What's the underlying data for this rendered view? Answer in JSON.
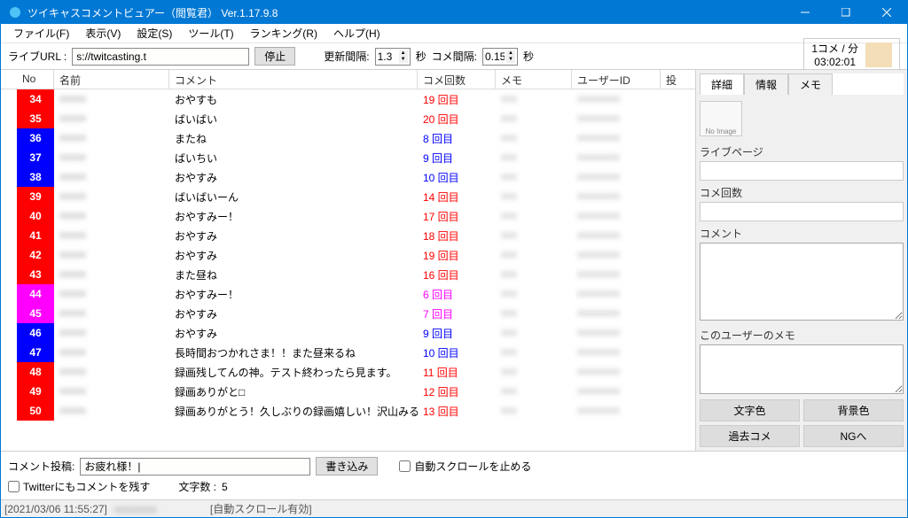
{
  "window": {
    "title": "ツイキャスコメントビュアー（閲覧君） Ver.1.17.9.8"
  },
  "menu": [
    "ファイル(F)",
    "表示(V)",
    "設定(S)",
    "ツール(T)",
    "ランキング(R)",
    "ヘルプ(H)"
  ],
  "toolbar": {
    "url_label": "ライブURL :",
    "url_value": "s://twitcasting.t",
    "stop": "停止",
    "refresh_label": "更新間隔:",
    "refresh_val": "1.3",
    "sec1": "秒",
    "comment_label": "コメ間隔:",
    "comment_val": "0.15",
    "sec2": "秒"
  },
  "status": {
    "line1": "1コメ / 分",
    "line2": "03:02:01"
  },
  "columns": {
    "scroll": "",
    "no": "No",
    "name": "名前",
    "comment": "コメント",
    "count": "コメ回数",
    "memo": "メモ",
    "uid": "ユーザーID",
    "q": "投"
  },
  "rows": [
    {
      "no": "34",
      "no_bg": "#ff0000",
      "comment": "おやすも",
      "count": "19 回目",
      "cc": "red"
    },
    {
      "no": "35",
      "no_bg": "#ff0000",
      "comment": "ばいばい",
      "count": "20 回目",
      "cc": "red"
    },
    {
      "no": "36",
      "no_bg": "#0000ff",
      "comment": "またね",
      "count": "8 回目",
      "cc": "blue"
    },
    {
      "no": "37",
      "no_bg": "#0000ff",
      "comment": "ばいちい",
      "count": "9 回目",
      "cc": "blue"
    },
    {
      "no": "38",
      "no_bg": "#0000ff",
      "comment": "おやすみ",
      "count": "10 回目",
      "cc": "blue"
    },
    {
      "no": "39",
      "no_bg": "#ff0000",
      "comment": "ばいばいーん",
      "count": "14 回目",
      "cc": "red"
    },
    {
      "no": "40",
      "no_bg": "#ff0000",
      "comment": "おやすみー！",
      "count": "17 回目",
      "cc": "red"
    },
    {
      "no": "41",
      "no_bg": "#ff0000",
      "comment": "おやすみ",
      "count": "18 回目",
      "cc": "red"
    },
    {
      "no": "42",
      "no_bg": "#ff0000",
      "comment": "おやすみ",
      "count": "19 回目",
      "cc": "red"
    },
    {
      "no": "43",
      "no_bg": "#ff0000",
      "comment": "また昼ね",
      "count": "16 回目",
      "cc": "red"
    },
    {
      "no": "44",
      "no_bg": "#ff00ff",
      "comment": "おやすみー！",
      "count": "6 回目",
      "cc": "magenta"
    },
    {
      "no": "45",
      "no_bg": "#ff00ff",
      "comment": "おやすみ",
      "count": "7 回目",
      "cc": "magenta"
    },
    {
      "no": "46",
      "no_bg": "#0000ff",
      "comment": "おやすみ",
      "count": "9 回目",
      "cc": "blue"
    },
    {
      "no": "47",
      "no_bg": "#0000ff",
      "comment": "長時間おつかれさま！！また昼来るね",
      "count": "10 回目",
      "cc": "blue"
    },
    {
      "no": "48",
      "no_bg": "#ff0000",
      "comment": "録画残してんの神。テスト終わったら見ます。",
      "count": "11 回目",
      "cc": "red"
    },
    {
      "no": "49",
      "no_bg": "#ff0000",
      "comment": "録画ありがと□",
      "count": "12 回目",
      "cc": "red"
    },
    {
      "no": "50",
      "no_bg": "#ff0000",
      "comment": "録画ありがとう！久しぶりの録画嬉しい！沢山みるねー😊",
      "count": "13 回目",
      "cc": "red"
    }
  ],
  "side": {
    "tabs": [
      "詳細",
      "情報",
      "メモ"
    ],
    "avatar": "No Image",
    "livepage": "ライブページ",
    "count": "コメ回数",
    "comment": "コメント",
    "usernote": "このユーザーのメモ",
    "btn_textcolor": "文字色",
    "btn_bgcolor": "背景色",
    "btn_pastcomment": "過去コメ",
    "btn_ng": "NGへ"
  },
  "bottom": {
    "post_label": "コメント投稿:",
    "post_value": "お疲れ様！|",
    "write": "書き込み",
    "stopscroll": "自動スクロールを止める",
    "twitter": "Twitterにもコメントを残す",
    "charcount_label": "文字数 :",
    "charcount_value": "5"
  },
  "statusbar": {
    "time": "[2021/03/06 11:55:27]",
    "scroll": "[自動スクロール有効]"
  }
}
